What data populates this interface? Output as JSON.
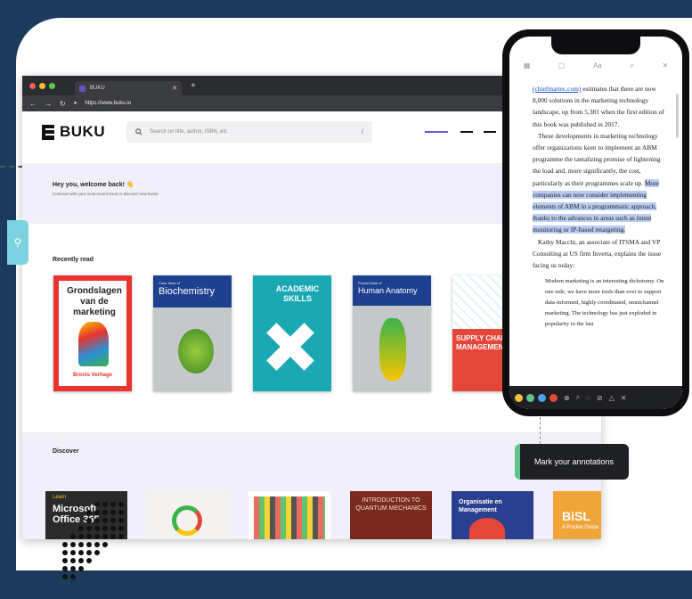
{
  "browser": {
    "tab_title": "BUKU",
    "url": "https://www.buku.io"
  },
  "app": {
    "logo_text": "BUKU",
    "search_placeholder": "Search on title, author, ISBN, etc",
    "search_shortcut": "/",
    "welcome_title": "Hey you, welcome back! 👋",
    "welcome_subtitle": "Continue with your most recent book or discover new books",
    "recently_read_label": "Recently read",
    "discover_label": "Discover"
  },
  "recent_books": [
    {
      "title": "Grondslagen van de marketing",
      "author": "Bronis Verhage",
      "color": "#e8342f"
    },
    {
      "title": "Biochemistry",
      "subtitle": "Color Atlas of",
      "color": "#1f3f8f"
    },
    {
      "title": "ACADEMIC SKILLS",
      "color": "#1aa8b3"
    },
    {
      "title": "Human Anatomy",
      "subtitle": "Pocket Atlas of",
      "color": "#1f3f8f"
    },
    {
      "title": "SUPPLY CHAIN MANAGEMENT",
      "color": "#e5463a"
    }
  ],
  "discover_books": [
    {
      "title": "Microsoft Office 365",
      "label": "Learn",
      "color": "#2a2a2a"
    },
    {
      "title": "",
      "color": "#f4f2ee"
    },
    {
      "title": "",
      "color": "#ffffff"
    },
    {
      "title": "INTRODUCTION TO QUANTUM MECHANICS",
      "color": "#7a2a1e"
    },
    {
      "title": "Organisatie en Management",
      "color": "#2a3f8f"
    },
    {
      "title": "BiSL",
      "subtitle": "A Pocket Guide",
      "color": "#f0a53a"
    }
  ],
  "reader": {
    "text_link": "(chiefmartec.com)",
    "text_1": " estimates that there are now 8,000 solutions in the marketing technology landscape, up from 5,381 when the first edition of this book was published in 2017.",
    "text_2": "These developments in marketing technology offer organizations keen to implement an ABM programme the tantalizing promise of lightening the load and, more significantly, the cost, particularly as their programmes scale up. ",
    "text_highlight": "More companies can now consider implementing elements of ABM in a programmatic approach, thanks to the advances in areas such as intent monitoring or IP-based retargeting.",
    "text_3": "Kathy Macchi, an associate of ITSMA and VP Consulting at US firm Inverta, explains the issue facing us today:",
    "quote": "Modern marketing is an interesting dichotomy. On one side, we have more tools than ever to support data-informed, highly coordinated, omnichannel marketing. The technology has just exploded in popularity in the last"
  },
  "reader_colors": [
    "#f5c33b",
    "#62c48b",
    "#4aa3e8",
    "#e5463a"
  ],
  "tooltip": "Mark your annotations"
}
